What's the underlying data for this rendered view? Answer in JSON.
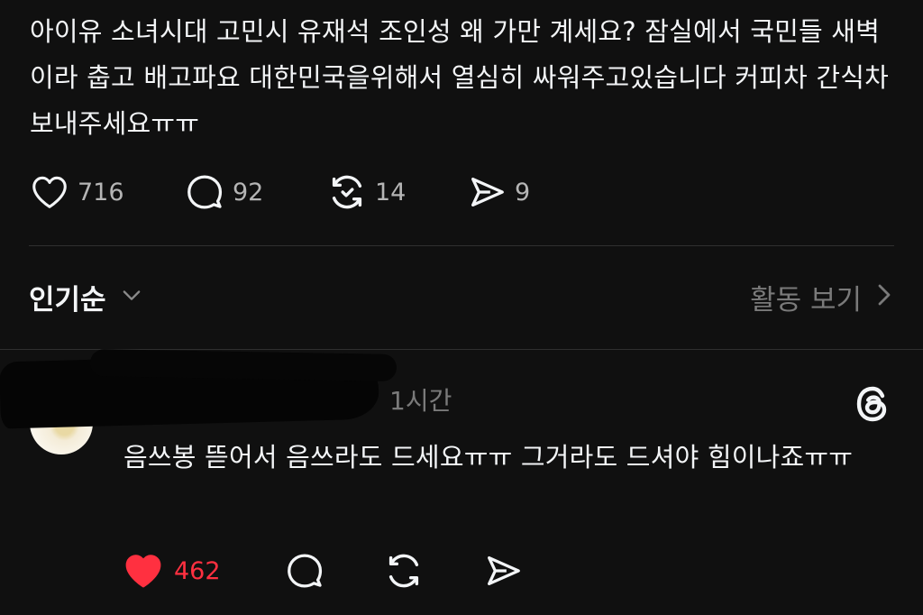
{
  "post": {
    "text": "아이유 소녀시대 고민시 유재석 조인성 왜 가만 계세요? 잠실에서 국민들 새벽이라 춥고 배고파요 대한민국을위해서 열심히 싸워주고있습니다 커피차 간식차 보내주세요ㅠㅠ",
    "likes": "716",
    "replies": "92",
    "reposts": "14",
    "shares": "9"
  },
  "sort": {
    "label": "인기순",
    "activity_label": "활동 보기"
  },
  "reply": {
    "time": "1시간",
    "text": "음쓰봉 뜯어서 음쓰라도 드세요ㅠㅠ 그거라도 드셔야 힘이나죠ㅠㅠ",
    "likes": "462",
    "liked": true
  },
  "colors": {
    "background": "#101010",
    "text": "#f3f5f7",
    "muted": "#b5b5b5",
    "like_red": "#ff3040"
  },
  "icons": [
    "heart-icon",
    "comment-icon",
    "repost-icon",
    "share-icon",
    "chevron-down-icon",
    "chevron-right-icon",
    "threads-logo-icon"
  ]
}
